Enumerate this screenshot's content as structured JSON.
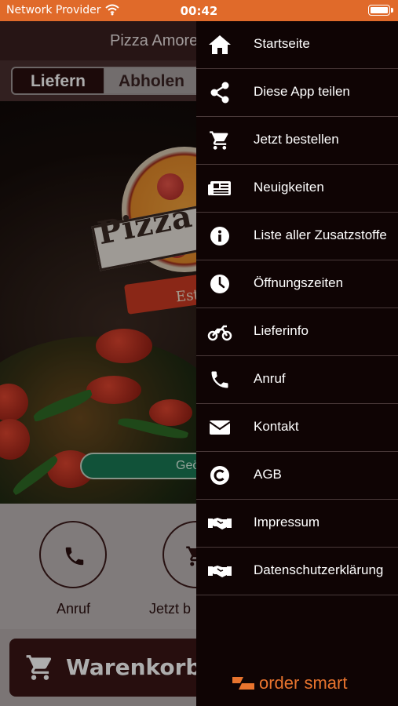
{
  "status_bar": {
    "provider": "Network Provider",
    "time": "00:42"
  },
  "app": {
    "title": "Pizza Amore",
    "tabs": [
      {
        "label": "Liefern",
        "active": true
      },
      {
        "label": "Abholen",
        "active": false
      }
    ],
    "hero": {
      "logo_text": "Pizza",
      "logo_est": "Est",
      "status_pill": "Geö"
    },
    "actions": [
      {
        "label": "Anruf",
        "icon": "phone-icon"
      },
      {
        "label": "Jetzt b",
        "icon": "cart-icon"
      }
    ],
    "cart_label": "Warenkorb"
  },
  "drawer": {
    "items": [
      {
        "label": "Startseite",
        "icon": "home-icon"
      },
      {
        "label": "Diese App teilen",
        "icon": "share-icon"
      },
      {
        "label": "Jetzt bestellen",
        "icon": "cart-icon"
      },
      {
        "label": "Neuigkeiten",
        "icon": "newspaper-icon"
      },
      {
        "label": "Liste aller Zusatzstoffe",
        "icon": "info-icon"
      },
      {
        "label": "Öffnungszeiten",
        "icon": "clock-icon"
      },
      {
        "label": "Lieferinfo",
        "icon": "motorcycle-icon"
      },
      {
        "label": "Anruf",
        "icon": "phone-icon"
      },
      {
        "label": "Kontakt",
        "icon": "envelope-icon"
      },
      {
        "label": "AGB",
        "icon": "copyright-icon"
      },
      {
        "label": "Impressum",
        "icon": "handshake-icon"
      },
      {
        "label": "Datenschutzerklärung",
        "icon": "handshake-icon"
      }
    ],
    "brand": "order smart"
  },
  "colors": {
    "status_bar": "#e06a2a",
    "drawer_bg": "#0f0404",
    "brand": "#e8742e",
    "cart_button": "#3a1616"
  }
}
